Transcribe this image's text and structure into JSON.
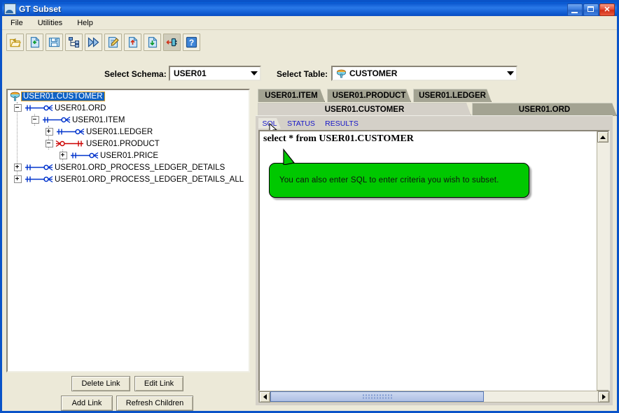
{
  "window": {
    "title": "GT Subset",
    "icon": "app-window-icon",
    "buttons": {
      "minimize": "minimize",
      "maximize": "maximize",
      "close": "close"
    }
  },
  "menu": {
    "items": [
      "File",
      "Utilities",
      "Help"
    ]
  },
  "toolbar": {
    "buttons": [
      {
        "name": "open-icon",
        "tip": "Open"
      },
      {
        "name": "new-document-icon",
        "tip": "New"
      },
      {
        "name": "save-icon",
        "tip": "Save"
      },
      {
        "name": "hierarchy-icon",
        "tip": "Hierarchy"
      },
      {
        "name": "run-fast-forward-icon",
        "tip": "Run"
      },
      {
        "name": "edit-document-icon",
        "tip": "Edit"
      },
      {
        "name": "import-document-icon",
        "tip": "Import"
      },
      {
        "name": "export-document-icon",
        "tip": "Export"
      },
      {
        "name": "connect-plug-icon",
        "tip": "Connect"
      },
      {
        "name": "help-icon",
        "tip": "Help"
      }
    ]
  },
  "selectors": {
    "schema_label": "Select Schema:",
    "schema_value": "USER01",
    "table_label": "Select Table:",
    "table_value": "CUSTOMER"
  },
  "tree": {
    "nodes": [
      {
        "label": "USER01.CUSTOMER",
        "depth": 0,
        "expander": "none",
        "selected": true,
        "icon": "table-icon",
        "rel": "none"
      },
      {
        "label": "USER01.ORD",
        "depth": 0,
        "expander": "minus",
        "selected": false,
        "icon": "none",
        "rel": "blue-crowsfoot"
      },
      {
        "label": "USER01.ITEM",
        "depth": 1,
        "expander": "minus",
        "selected": false,
        "icon": "none",
        "rel": "blue-crowsfoot"
      },
      {
        "label": "USER01.LEDGER",
        "depth": 2,
        "expander": "plus",
        "selected": false,
        "icon": "none",
        "rel": "blue-crowsfoot"
      },
      {
        "label": "USER01.PRODUCT",
        "depth": 2,
        "expander": "minus",
        "selected": false,
        "icon": "none",
        "rel": "red-reverse"
      },
      {
        "label": "USER01.PRICE",
        "depth": 3,
        "expander": "plus",
        "selected": false,
        "icon": "none",
        "rel": "blue-crowsfoot"
      },
      {
        "label": "USER01.ORD_PROCESS_LEDGER_DETAILS",
        "depth": 0,
        "expander": "plus",
        "selected": false,
        "icon": "none",
        "rel": "blue-crowsfoot"
      },
      {
        "label": "USER01.ORD_PROCESS_LEDGER_DETAILS_ALL",
        "depth": 0,
        "expander": "plus",
        "selected": false,
        "icon": "none",
        "rel": "blue-crowsfoot"
      }
    ]
  },
  "link_buttons": {
    "delete_link": "Delete Link",
    "edit_link": "Edit Link",
    "add_link": "Add Link",
    "refresh_children": "Refresh Children"
  },
  "tabs": {
    "row1": [
      {
        "label": "USER01.ITEM",
        "active": false
      },
      {
        "label": "USER01.PRODUCT",
        "active": false
      },
      {
        "label": "USER01.LEDGER",
        "active": false
      }
    ],
    "row2": [
      {
        "label": "USER01.CUSTOMER",
        "active": true
      },
      {
        "label": "USER01.ORD",
        "active": false
      }
    ],
    "subtabs": [
      {
        "label": "SQL",
        "active": true
      },
      {
        "label": "STATUS",
        "active": false
      },
      {
        "label": "RESULTS",
        "active": false
      }
    ]
  },
  "editor": {
    "sql": "select * from USER01.CUSTOMER",
    "callout": "You can also enter SQL to enter criteria you wish to subset."
  },
  "colors": {
    "titlebar": "#0a57cf",
    "window_bg": "#ece9d8",
    "tab_inactive": "#a3a392",
    "tab_active": "#d4d0c8",
    "selection": "#1062c4",
    "callout": "#00c800",
    "relation_blue": "#0033cc",
    "relation_red": "#cc0000",
    "subtab_text": "#1515c8"
  }
}
